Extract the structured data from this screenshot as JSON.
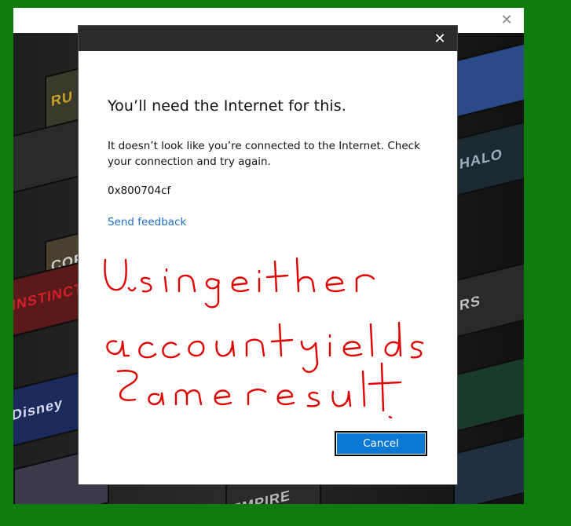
{
  "background_window": {
    "close_glyph": "✕",
    "tiles": [
      {
        "label": "RU",
        "color": "#c9a227"
      },
      {
        "label": "CORE",
        "color": "#cfcfcf"
      },
      {
        "label": "INSTINCT",
        "color": "#d0202a"
      },
      {
        "label": "Disney",
        "color": "#d8d8f0"
      },
      {
        "label": "HALO",
        "color": "#9ab0c0"
      },
      {
        "label": "RS",
        "color": "#c0c0c0"
      },
      {
        "label": "EMPIRE",
        "color": "#b8b8b8"
      }
    ]
  },
  "dialog": {
    "close_glyph": "✕",
    "heading": "You’ll need the Internet for this.",
    "message": "It doesn’t look like you’re connected to the Internet. Check your connection and try again.",
    "error_code": "0x800704cf",
    "feedback_link": "Send feedback",
    "cancel_label": "Cancel",
    "handwritten_note": "Usingeither accountyields Same result.",
    "colors": {
      "titlebar": "#2b2b2b",
      "link": "#1e6fc6",
      "button": "#0a78d4",
      "annotation": "#e00000",
      "desktop": "#107c10"
    }
  }
}
